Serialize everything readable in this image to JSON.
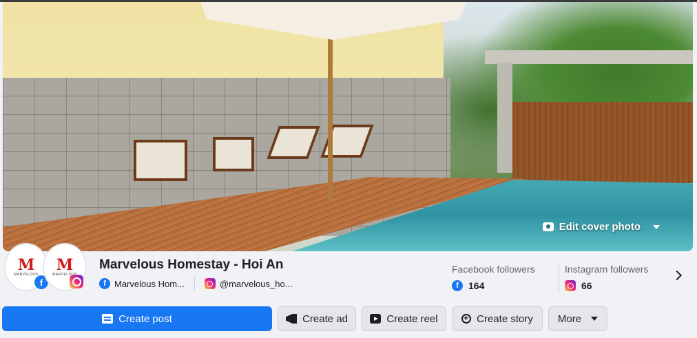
{
  "cover": {
    "edit_label": "Edit cover photo"
  },
  "page": {
    "name": "Marvelous Homestay - Hoi An",
    "avatar_letter": "M",
    "avatar_sub": "MARVELOUS"
  },
  "accounts": [
    {
      "platform": "facebook",
      "handle": "Marvelous Hom..."
    },
    {
      "platform": "instagram",
      "handle": "@marvelous_ho..."
    }
  ],
  "stats": {
    "facebook": {
      "label": "Facebook followers",
      "value": "164"
    },
    "instagram": {
      "label": "Instagram followers",
      "value": "66"
    }
  },
  "actions": {
    "create_post": "Create post",
    "create_ad": "Create ad",
    "create_reel": "Create reel",
    "create_story": "Create story",
    "more": "More"
  },
  "colors": {
    "primary": "#1877f2",
    "background": "#f0f2f5",
    "brand_red": "#d11b1f"
  }
}
